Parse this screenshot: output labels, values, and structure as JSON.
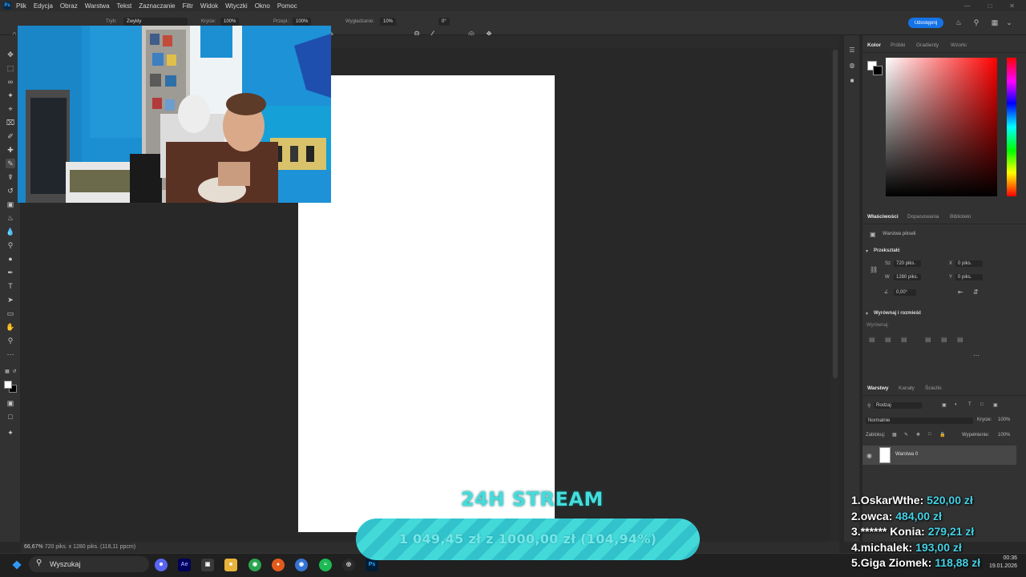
{
  "menu": {
    "items": [
      "Plik",
      "Edycja",
      "Obraz",
      "Warstwa",
      "Tekst",
      "Zaznaczanie",
      "Filtr",
      "Widok",
      "Wtyczki",
      "Okno",
      "Pomoc"
    ]
  },
  "options_bar": {
    "mode_label": "Tryb:",
    "mode_value": "Zwykły",
    "opacity_label": "Krycie:",
    "opacity_value": "100%",
    "flow_label": "Przepł.:",
    "flow_value": "100%",
    "smoothing_label": "Wygładzanie:",
    "smoothing_value": "10%",
    "angle_value": "0°",
    "share_label": "Udostępnij"
  },
  "status": {
    "zoom": "66,67%",
    "doc_info": "720 piks. x 1280 piks. (118,11 ppcm)"
  },
  "color_panel": {
    "tabs": [
      "Kolor",
      "Próbki",
      "Gradienty",
      "Wzorki"
    ]
  },
  "properties_panel": {
    "tabs": [
      "Właściwości",
      "Dopasowania",
      "Biblioteki"
    ],
    "layer_type": "Warstwa pikseli",
    "transform_title": "Przekształć",
    "w_label": "Sz",
    "w_value": "720 piks.",
    "h_label": "W",
    "h_value": "1280 piks.",
    "x_label": "X",
    "x_value": "0 piks.",
    "y_label": "Y",
    "y_value": "0 piks.",
    "angle_value": "0,00°",
    "align_title": "Wyrównaj i rozmieść",
    "align_sub": "Wyrównaj:"
  },
  "layers_panel": {
    "tabs": [
      "Warstwy",
      "Kanały",
      "Ścieżki"
    ],
    "filter_label": "Rodzaj",
    "blend_mode": "Normalnie",
    "opacity_label": "Krycie:",
    "opacity_value": "100%",
    "lock_label": "Zablokuj:",
    "fill_label": "Wypełnienie:",
    "fill_value": "100%",
    "layer_name": "Warstwa 0"
  },
  "taskbar": {
    "search_placeholder": "Wyszukaj",
    "time": "00:36",
    "date": "19.01.2026"
  },
  "stream": {
    "title": "24H STREAM",
    "goal_text": "1 049,45 zł z 1000,00 zł (104,94%)",
    "goal_fraction": 1.0494,
    "donors": [
      {
        "rank": "1.",
        "name": "OskarWthe:",
        "amount": "520,00 zł"
      },
      {
        "rank": "2.",
        "name": "owca:",
        "amount": "484,00 zł"
      },
      {
        "rank": "3.",
        "name": "****** Konia:",
        "amount": "279,21 zł"
      },
      {
        "rank": "4.",
        "name": "michalek:",
        "amount": "193,00 zł"
      },
      {
        "rank": "5.",
        "name": "Giga Ziomek:",
        "amount": "118,88 zł"
      }
    ]
  }
}
